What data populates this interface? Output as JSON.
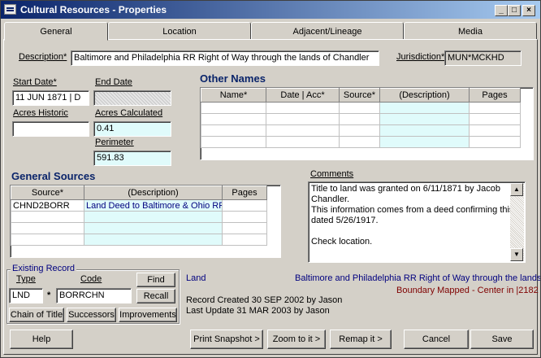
{
  "window": {
    "title": "Cultural Resources - Properties"
  },
  "tabs": [
    "General",
    "Location",
    "Adjacent/Lineage",
    "Media"
  ],
  "description": {
    "label": "Description*",
    "value": "Baltimore and Philadelphia RR Right of Way through the lands of Chandler"
  },
  "jurisdiction": {
    "label": "Jurisdiction*",
    "value": "MUN*MCKHD"
  },
  "start_date": {
    "label": "Start Date*",
    "value": "11 JUN 1871 | D"
  },
  "end_date": {
    "label": "End Date",
    "value": ""
  },
  "acres_historic": {
    "label": "Acres Historic",
    "value": ""
  },
  "acres_calculated": {
    "label": "Acres Calculated",
    "value": "0.41"
  },
  "perimeter": {
    "label": "Perimeter",
    "value": "591.83"
  },
  "other_names": {
    "title": "Other Names",
    "columns": [
      "Name*",
      "Date | Acc*",
      "Source*",
      "(Description)",
      "Pages"
    ]
  },
  "general_sources": {
    "title": "General Sources",
    "columns": [
      "Source*",
      "(Description)",
      "Pages"
    ],
    "rows": [
      {
        "source": "CHND2BORR",
        "description": "Land Deed to Baltimore & Ohio RR",
        "pages": ""
      }
    ]
  },
  "comments": {
    "label": "Comments",
    "lines": [
      "Title to land was granted on 6/11/1871 by Jacob",
      "Chandler.",
      "This information comes from a deed confirming this",
      "dated 5/26/1917.",
      "",
      "Check location."
    ]
  },
  "existing_record": {
    "label": "Existing Record",
    "type_label": "Type",
    "code_label": "Code",
    "type_value": "LND",
    "separator": "*",
    "code_value": "BORRCHN",
    "find_label": "Find",
    "recall_label": "Recall",
    "chain_label": "Chain of Title",
    "successors_label": "Successors",
    "improvements_label": "Improvements"
  },
  "record_info": {
    "type": "Land",
    "name": "Baltimore and Philadelphia RR Right of Way through the lands",
    "status": "Boundary Mapped - Center in |2182",
    "created": "Record Created 30 SEP 2002 by Jason",
    "updated": "Last Update 31 MAR 2003 by Jason"
  },
  "buttons": {
    "help": "Help",
    "print": "Print Snapshot >",
    "zoom": "Zoom to it >",
    "remap": "Remap it >",
    "cancel": "Cancel",
    "save": "Save"
  },
  "colors": {
    "titlebar": "#0a246a",
    "section": "#0a246a",
    "desc_cell": "#e0fbfb",
    "status_red": "#7f0000"
  }
}
